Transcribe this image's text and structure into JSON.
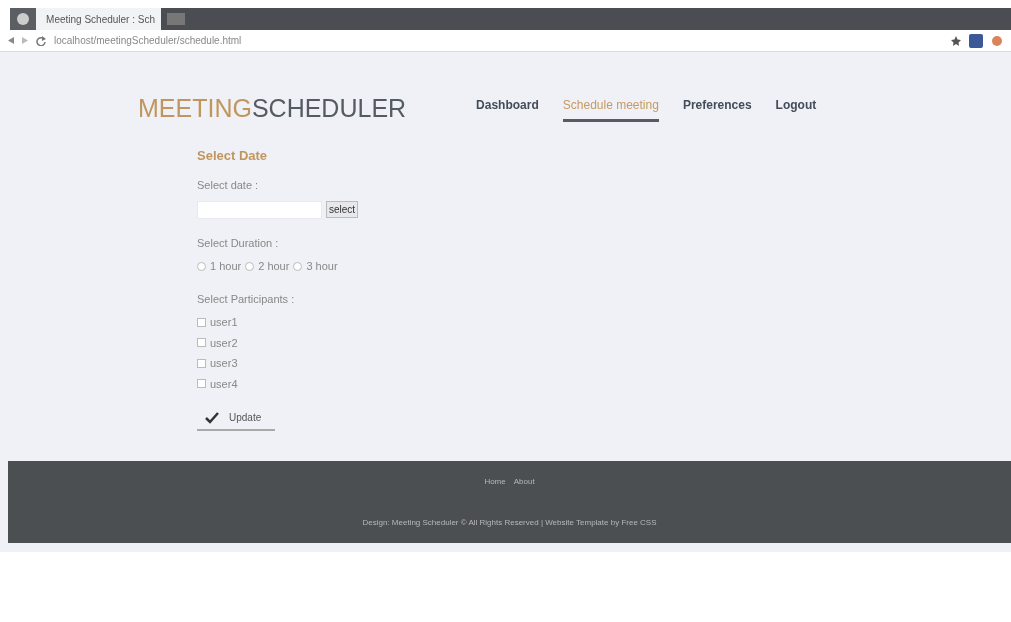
{
  "browser": {
    "tab_title": "Meeting Scheduler : Sch",
    "url": "localhost/meetingScheduler/schedule.html"
  },
  "header": {
    "logo_accent": "MEETING",
    "logo_rest": "SCHEDULER"
  },
  "nav": [
    {
      "label": "Dashboard",
      "selected": false
    },
    {
      "label": "Schedule meeting",
      "selected": true
    },
    {
      "label": "Preferences",
      "selected": false
    },
    {
      "label": "Logout",
      "selected": false
    }
  ],
  "form": {
    "title": "Select Date",
    "date_label": "Select date :",
    "select_button": "select",
    "duration_label": "Select Duration :",
    "durations": [
      {
        "label": "1 hour",
        "selected": false
      },
      {
        "label": "2 hour",
        "selected": false
      },
      {
        "label": "3 hour",
        "selected": false
      }
    ],
    "participants_label": "Select Participants :",
    "participants": [
      {
        "label": "user1",
        "checked": false
      },
      {
        "label": "user2",
        "checked": false
      },
      {
        "label": "user3",
        "checked": false
      },
      {
        "label": "user4",
        "checked": false
      }
    ],
    "update_button": "Update"
  },
  "footer": {
    "links": [
      "Home",
      "About"
    ],
    "copyright": "Design: Meeting Scheduler © All Rights Reserved | Website Template by Free CSS"
  }
}
